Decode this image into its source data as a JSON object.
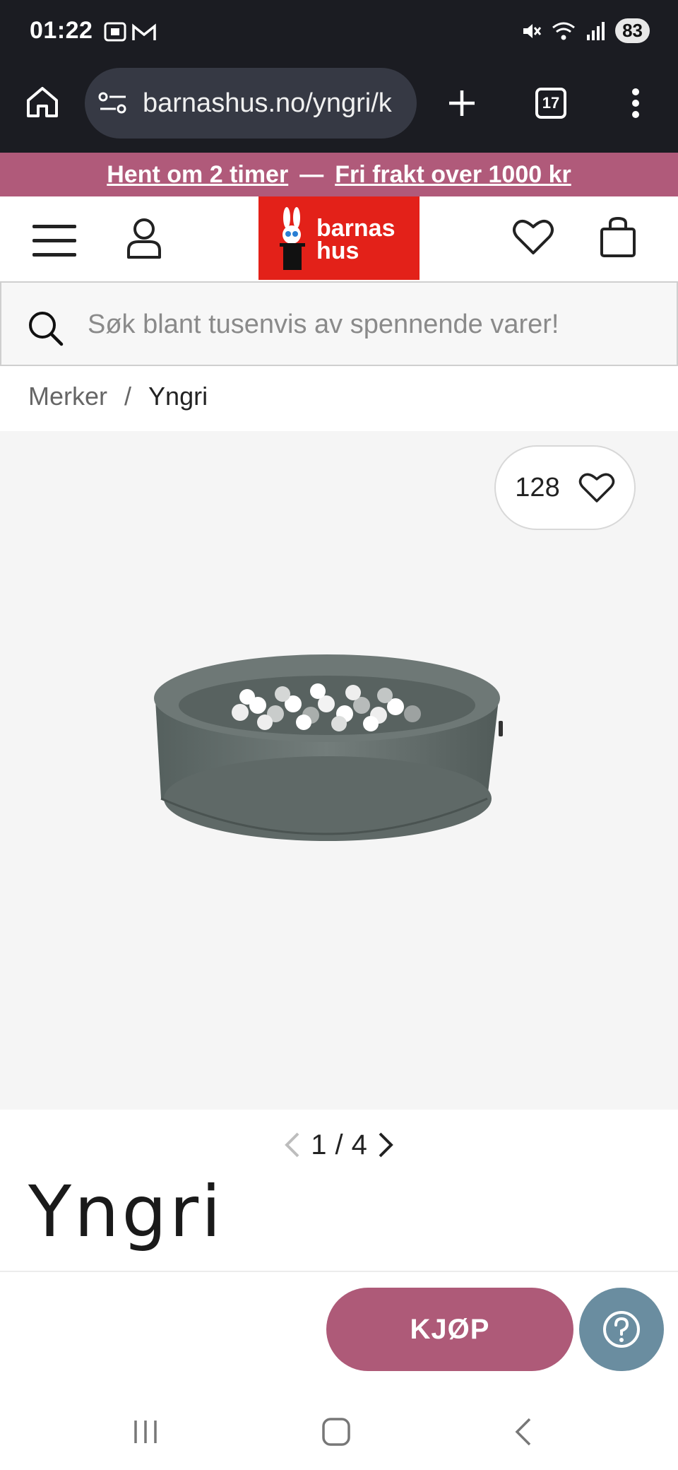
{
  "status_bar": {
    "time": "01:22",
    "battery": "83",
    "icons": [
      "screenshot-icon",
      "gmail-icon",
      "mute-icon",
      "wifi-icon",
      "signal-icon",
      "battery-icon"
    ]
  },
  "browser": {
    "url": "barnashus.no/yngri/k",
    "tab_count": "17",
    "icons": [
      "home-icon",
      "site-settings-icon",
      "new-tab-icon",
      "tabs-icon",
      "more-menu-icon"
    ]
  },
  "promo": {
    "part1": "Hent om 2 timer",
    "separator": "—",
    "part2": "Fri frakt over 1000 kr",
    "color": "#b05a7a"
  },
  "header": {
    "logo_line1": "barnas",
    "logo_line2": "hus",
    "logo_color": "#e32119"
  },
  "search": {
    "placeholder": "Søk blant tusenvis av spennende varer!"
  },
  "breadcrumb": {
    "items": [
      "Merker",
      "Yngri"
    ],
    "separator": "/"
  },
  "product": {
    "favorite_count": "128",
    "image_index": "1",
    "image_separator": "/",
    "image_total": "4",
    "brand_name": "Yngri"
  },
  "actions": {
    "buy_label": "KJØP",
    "buy_color": "#ae5a78",
    "help_color": "#6a8da0"
  }
}
